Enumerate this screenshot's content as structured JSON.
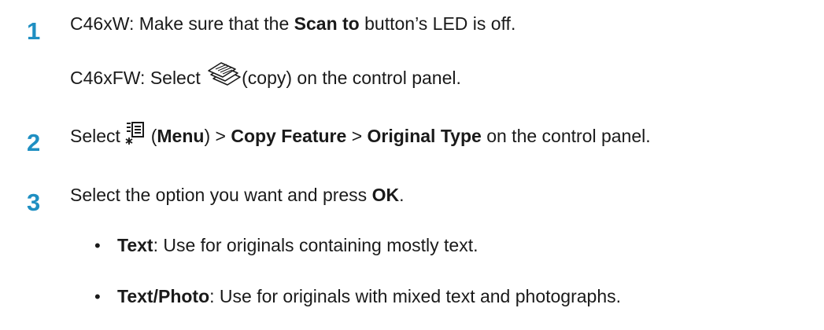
{
  "colors": {
    "step_number": "#1f8fc2",
    "text": "#1a1a1a"
  },
  "steps": [
    {
      "number": "1",
      "lines": [
        {
          "prefix": "C46xW: Make sure that the ",
          "bold": "Scan to",
          "suffix": " button’s LED is off."
        },
        {
          "prefix": "C46xFW: Select ",
          "icon": "copy-icon",
          "suffix": "(copy) on the control panel."
        }
      ]
    },
    {
      "number": "2",
      "icon": "menu-icon",
      "p1": "Select ",
      "p2": " (",
      "b1": "Menu",
      "p3": ") > ",
      "b2": "Copy Feature",
      "p4": " > ",
      "b3": "Original Type",
      "p5": " on the control panel."
    },
    {
      "number": "3",
      "prefix": "Select the option you want and press ",
      "bold": "OK",
      "suffix": ".",
      "options": [
        {
          "bullet": "•",
          "label": "Text",
          "desc": ": Use for originals containing mostly text."
        },
        {
          "bullet": "•",
          "label": "Text/Photo",
          "desc": ": Use for originals with mixed text and photographs."
        }
      ]
    }
  ]
}
